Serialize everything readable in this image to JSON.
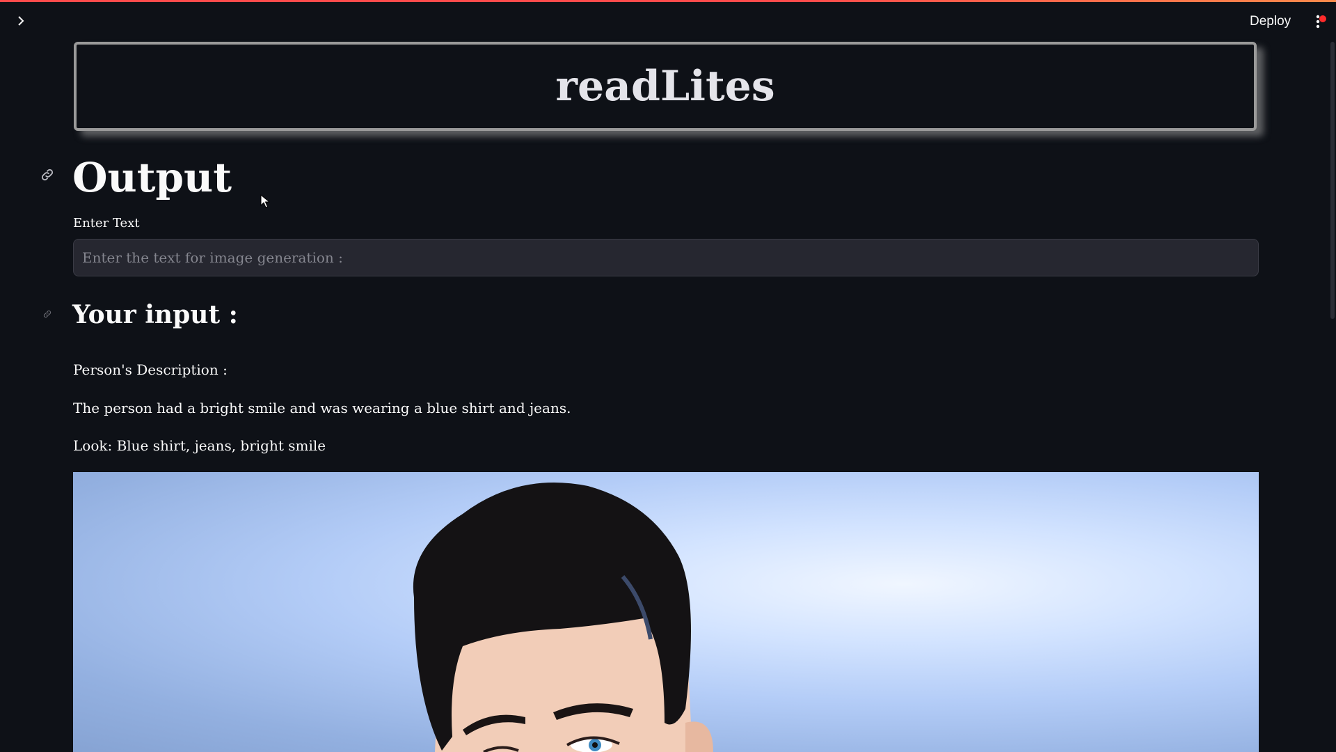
{
  "app": {
    "title": "readLites"
  },
  "toolbar": {
    "sidebar_toggle_icon": "chevron-right-icon",
    "deploy_label": "Deploy",
    "menu_icon": "kebab-menu-icon",
    "accent_color": "#ff4b4b"
  },
  "main": {
    "output_heading": "Output",
    "text_input": {
      "label": "Enter Text",
      "value": "",
      "placeholder": "Enter the text for image generation :"
    },
    "input_heading": "Your input :",
    "description_label": "Person's Description :",
    "description_text": "The person had a bright smile and was wearing a blue shirt and jeans.",
    "look_text": "Look: Blue shirt, jeans, bright smile",
    "generated_image_icon": "portrait-image"
  }
}
